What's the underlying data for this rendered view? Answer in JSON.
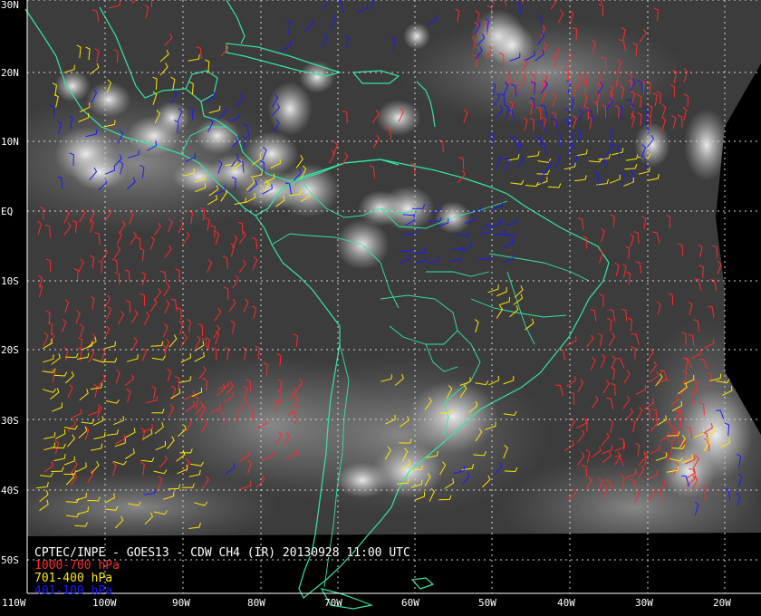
{
  "caption": "CPTEC/INPE - GOES13 - CDW CH4 (IR) 20130928 11:00 UTC",
  "legend": [
    {
      "label": "1000-700 hPa",
      "color": "#ff2a2a"
    },
    {
      "label": "701-400 hPa",
      "color": "#ffe600"
    },
    {
      "label": "401-100 hPa",
      "color": "#1a1aff"
    }
  ],
  "lat_labels": [
    "30N",
    "20N",
    "10N",
    "EQ",
    "10S",
    "20S",
    "30S",
    "40S",
    "50S"
  ],
  "lon_labels": [
    "110W",
    "100W",
    "90W",
    "80W",
    "70W",
    "60W",
    "50W",
    "40W",
    "30W",
    "20W"
  ],
  "colors": {
    "coastline": "#33e6a0",
    "grid": "#d0d0d0",
    "space": "#000000"
  }
}
